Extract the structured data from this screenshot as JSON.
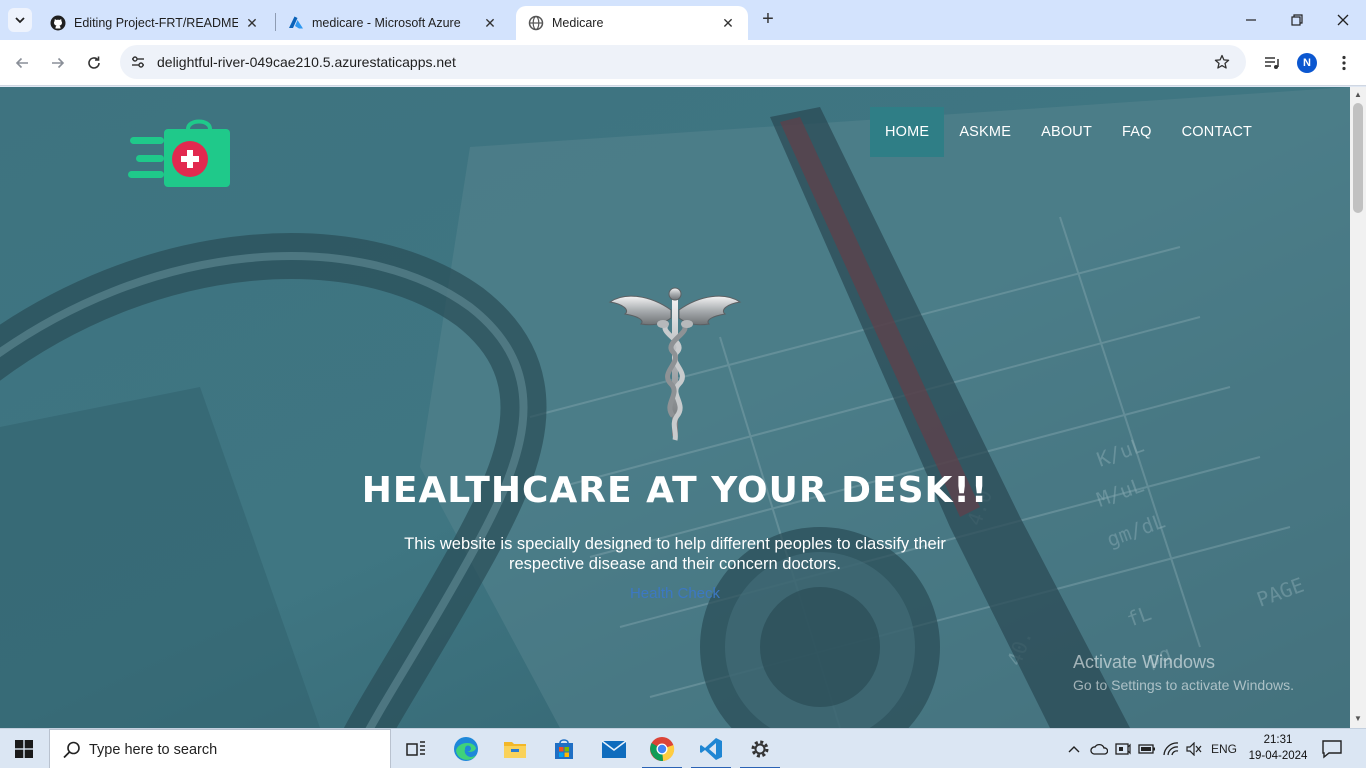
{
  "browser": {
    "tabs": [
      {
        "title": "Editing Project-FRT/README.m",
        "icon": "github-icon",
        "active": false
      },
      {
        "title": "medicare - Microsoft Azure",
        "icon": "azure-icon",
        "active": false
      },
      {
        "title": "Medicare",
        "icon": "globe-icon",
        "active": true
      }
    ],
    "url": "delightful-river-049cae210.5.azurestaticapps.net",
    "profile_initial": "N"
  },
  "page": {
    "nav": [
      "HOME",
      "ASKME",
      "ABOUT",
      "FAQ",
      "CONTACT"
    ],
    "active_nav": "HOME",
    "hero_title": "HEALTHCARE AT YOUR DESK!!",
    "hero_subtitle": "This website is specially designed to help different peoples to classify their respective disease and their concern doctors.",
    "hero_link": "Health Check",
    "watermark": {
      "line1": "Activate Windows",
      "line2": "Go to Settings to activate Windows."
    },
    "colors": {
      "overlay": "#3a6f7c",
      "nav_active": "#2f7e86",
      "logo_green": "#1fc98a",
      "logo_red": "#e2294f",
      "link": "#3c78c3"
    }
  },
  "taskbar": {
    "search_placeholder": "Type here to search",
    "apps": [
      "task-view-icon",
      "edge-icon",
      "file-explorer-icon",
      "store-icon",
      "mail-icon",
      "chrome-icon",
      "vscode-icon",
      "settings-icon"
    ],
    "language": "ENG",
    "time": "21:31",
    "date": "19-04-2024"
  }
}
